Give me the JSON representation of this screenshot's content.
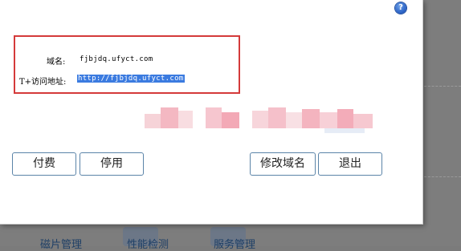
{
  "dialog": {
    "help_icon": "question-mark-icon",
    "domain_label": "域名:",
    "domain_value": "fjbjdq.ufyct.com",
    "access_label": "T+访问地址:",
    "access_url": "http://fjbjdq.ufyct.com",
    "buttons": {
      "pay": "付费",
      "disable": "停用",
      "modify_domain": "修改域名",
      "exit": "退出"
    }
  },
  "background": {
    "links": [
      "磁片管理",
      "性能检测",
      "服务管理"
    ]
  },
  "colors": {
    "highlight_border": "#d43a3a",
    "selection": "#3b7be0",
    "button_border": "#5b84a8",
    "help_icon": "#2a62c6"
  }
}
